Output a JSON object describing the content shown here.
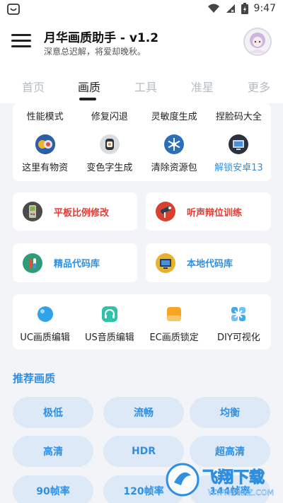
{
  "status_bar": {
    "time": "9:47"
  },
  "header": {
    "title": "月华画质助手 - v1.2",
    "subtitle": "深意总迟解，将爱却晚秋。"
  },
  "tabs": [
    "首页",
    "画质",
    "工具",
    "准星",
    "更多"
  ],
  "top_grid": {
    "row1": [
      "性能模式",
      "修复闪退",
      "灵敏度生成",
      "捏脸码大全"
    ],
    "row2": [
      {
        "label": "这里有物资",
        "icon": "coins-icon"
      },
      {
        "label": "变色字生成",
        "icon": "sushi-icon"
      },
      {
        "label": "清除资源包",
        "icon": "snowflake-icon"
      },
      {
        "label": "解锁安卓13",
        "icon": "monitor-icon"
      }
    ]
  },
  "feature_cards": [
    {
      "label": "平板比例修改",
      "icon": "gameboy-icon"
    },
    {
      "label": "听声辩位训练",
      "icon": "telescope-icon"
    },
    {
      "label": "精品代码库",
      "icon": "test-tubes-icon"
    },
    {
      "label": "本地代码库",
      "icon": "desktop-icon"
    }
  ],
  "editors": [
    {
      "label": "UC画质编辑",
      "icon": "blue-circle-icon"
    },
    {
      "label": "US音质编辑",
      "icon": "headphones-icon"
    },
    {
      "label": "EC画质锁定",
      "icon": "orange-card-icon"
    },
    {
      "label": "DIY可视化",
      "icon": "grid-icon"
    }
  ],
  "recommend": {
    "title": "推荐画质",
    "chips": [
      "极低",
      "流畅",
      "均衡",
      "高清",
      "HDR",
      "超高清",
      "90帧率",
      "120帧率",
      "144帧率"
    ]
  },
  "watermark": {
    "brand": "飞翔下载",
    "url": "WWW.FXXZ.COM"
  },
  "colors": {
    "accent": "#2f8fe3",
    "danger": "#e53a32",
    "chip_bg": "#dde9f6"
  }
}
